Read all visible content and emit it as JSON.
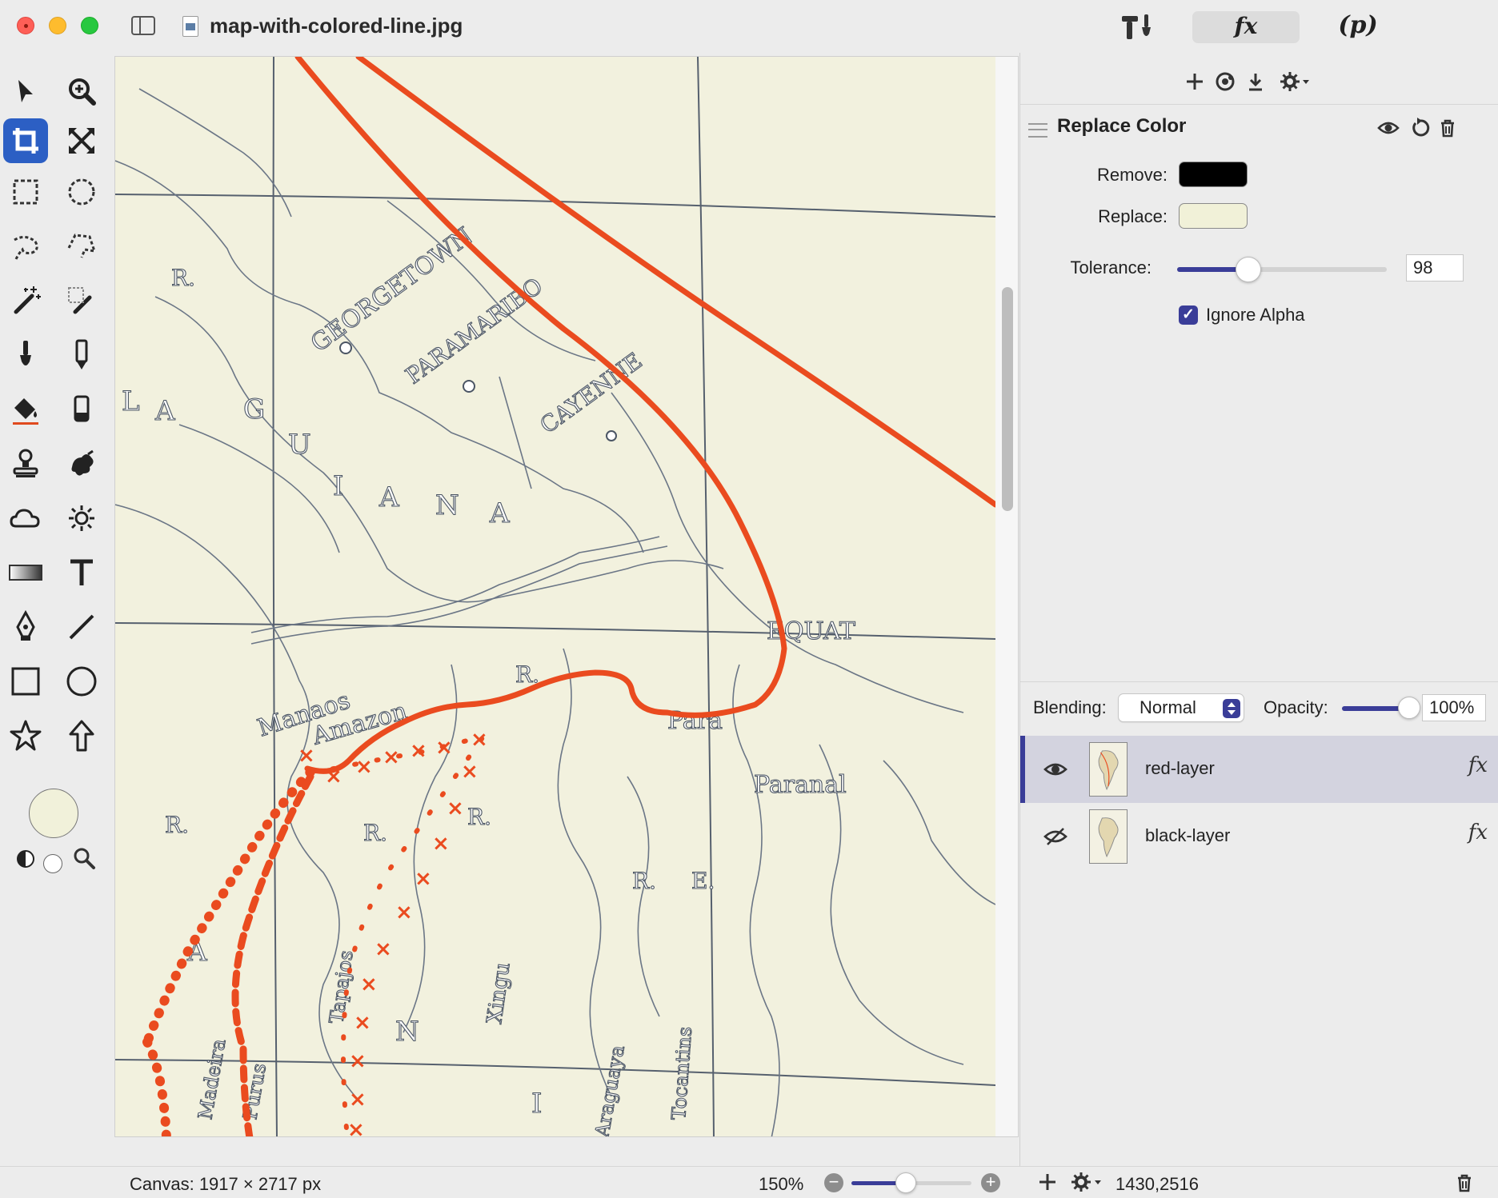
{
  "window": {
    "title": "map-with-colored-line.jpg",
    "tabs": {
      "tools_label": "tools",
      "fx_label": "fx",
      "p_label": "(p)"
    }
  },
  "tools": [
    "arrow-select",
    "zoom",
    "crop",
    "transform",
    "rect-select",
    "ellipse-select",
    "lasso",
    "polygon-lasso",
    "magic-wand",
    "color-select-wand",
    "brush",
    "pencil",
    "paint-bucket",
    "eraser",
    "clone-stamp",
    "smudge",
    "blur",
    "brightness",
    "gradient",
    "text",
    "pen",
    "line",
    "rectangle",
    "circle",
    "star",
    "arrow-shape"
  ],
  "colors": {
    "foreground": "#f1f1da",
    "accent": "#3a3d98",
    "selected_tool": "#2c5fc4",
    "route_red": "#ea4b1f",
    "map_paper": "#f2f1de"
  },
  "map_labels": [
    "GEORGETOWN",
    "PARAMARIBO",
    "CAYENNE",
    "G",
    "U",
    "I",
    "A",
    "N",
    "A",
    "L",
    "A",
    "R.",
    "EQUAT",
    "Manaos",
    "Amazon",
    "R.",
    "Para",
    "Paranal",
    "R.",
    "R.",
    "R.",
    "Xingu",
    "Tapajos",
    "Araguaya",
    "Tocantins",
    "Madeira",
    "Purus",
    "R.",
    "E.",
    "A",
    "N",
    "I"
  ],
  "effect": {
    "title": "Replace Color",
    "remove_label": "Remove:",
    "remove_color": "#000000",
    "replace_label": "Replace:",
    "replace_color": "#f1f1d8",
    "tolerance_label": "Tolerance:",
    "tolerance_value": "98",
    "tolerance_fraction": 0.34,
    "ignore_alpha_label": "Ignore Alpha",
    "ignore_alpha_checked": true
  },
  "layers_panel": {
    "blending_label": "Blending:",
    "blending_value": "Normal",
    "opacity_label": "Opacity:",
    "opacity_value": "100%",
    "opacity_fraction": 1.0,
    "layers": [
      {
        "name": "red-layer",
        "visible": true,
        "selected": true,
        "fx": "fx"
      },
      {
        "name": "black-layer",
        "visible": false,
        "selected": false,
        "fx": "fx"
      }
    ]
  },
  "status": {
    "canvas_info": "Canvas: 1917 × 2717 px",
    "zoom": "150%",
    "zoom_fraction": 0.45,
    "coords": "1430,2516"
  }
}
